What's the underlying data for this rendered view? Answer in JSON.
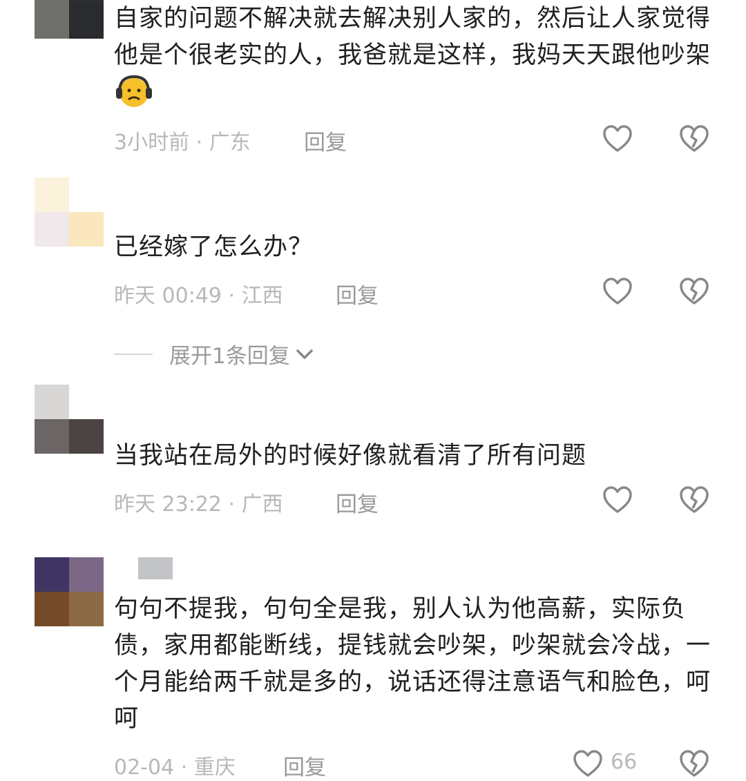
{
  "comments": [
    {
      "text": "自家的问题不解决就去解决别人家的，然后让人家觉得他是个很老实的人，我爸就是这样，我妈天天跟他吵架",
      "emoji": "headphones-face-emoji",
      "time": "3小时前",
      "location": "广东",
      "reply_label": "回复",
      "avatar_colors": [
        "#6e6e6a",
        "#2c2d31",
        "#6f6f6b",
        "#2a2b2f"
      ]
    },
    {
      "text": "已经嫁了怎么办？",
      "time": "昨天 00:49",
      "location": "江西",
      "reply_label": "回复",
      "expand_label": "展开1条回复",
      "avatar_colors": [
        "#fbf2dc",
        "#ffffff",
        "#f0e8ea",
        "#fbe7bd"
      ]
    },
    {
      "text": "当我站在局外的时候好像就看清了所有问题",
      "time": "昨天 23:22",
      "location": "广西",
      "reply_label": "回复",
      "avatar_colors": [
        "#d9d7d6",
        "#ffffff",
        "#6b6665",
        "#4b4442"
      ]
    },
    {
      "text": "句句不提我，句句全是我，别人认为他高薪，实际负债，家用都能断线，提钱就会吵架，吵架就会冷战，一个月能给两千就是多的，说话还得注意语气和脸色，呵呵",
      "time": "02-04",
      "location": "重庆",
      "reply_label": "回复",
      "like_count": "66",
      "avatar_colors": [
        "#403462",
        "#7b6886",
        "#754a28",
        "#8c6a45"
      ]
    }
  ],
  "separator": "·",
  "icons": {
    "like": "heart-outline-icon",
    "dislike": "broken-heart-icon",
    "expand": "chevron-down-icon"
  },
  "colors": {
    "text": "#202020",
    "meta": "#b8b8b8",
    "icon": "#888888"
  }
}
